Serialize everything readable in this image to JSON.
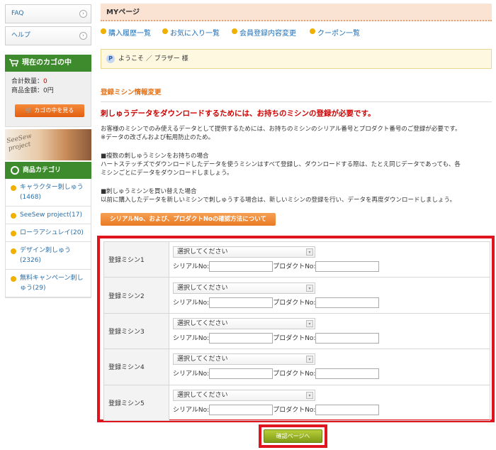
{
  "sidebar": {
    "links": [
      {
        "label": "FAQ"
      },
      {
        "label": "ヘルプ"
      }
    ],
    "cart": {
      "title": "現在のカゴの中",
      "total_qty_label": "合計数量：",
      "total_qty_value": "0",
      "total_price_label": "商品金額：",
      "total_price_value": "0円",
      "view_button": "カゴの中を見る"
    },
    "banner": {
      "logo_text": "SeeSew project"
    },
    "categories": {
      "title": "商品カテゴリ",
      "items": [
        {
          "label": "キャラクター刺しゅう(1468)"
        },
        {
          "label": "SeeSew project(17)"
        },
        {
          "label": "ローラアシュレイ(20)"
        },
        {
          "label": "デザイン刺しゅう(2326)"
        },
        {
          "label": "無料キャンペーン刺しゅう(29)"
        }
      ]
    }
  },
  "main": {
    "page_title": "MYページ",
    "tabs": [
      {
        "label": "購入履歴一覧"
      },
      {
        "label": "お気に入り一覧"
      },
      {
        "label": "会員登録内容変更"
      },
      {
        "label": "クーポン一覧"
      }
    ],
    "welcome": {
      "icon_letter": "P",
      "text": "ようこそ ／ ブラザー 様"
    },
    "section_title": "登録ミシン情報変更",
    "notice": "刺しゅうデータをダウンロードするためには、お持ちのミシンの登録が必要です。",
    "paragraphs": [
      "お客様のミシンでのみ使えるデータとして提供するためには、お持ちのミシンのシリアル番号とプロダクト番号のご登録が必要です。",
      "※データの改ざんおよび転用防止のため。",
      "■複数の刺しゅうミシンをお持ちの場合",
      "ハートステッチズでダウンロードしたデータを使うミシンはすべて登録し、ダウンロードする際は、たとえ同じデータであっても、各",
      "ミシンごとにデータをダウンロードしましょう。",
      "■刺しゅうミシンを買い替えた場合",
      "以前に購入したデータを新しいミシンで刺しゅうする場合は、新しいミシンの登録を行い、データを再度ダウンロードしましょう。"
    ],
    "help_button": "シリアルNo、および、プロダクトNoの確認方法について",
    "machines": [
      {
        "label": "登録ミシン1",
        "select": "選択してください",
        "serial_label": "シリアルNo:",
        "serial_value": "",
        "product_label": "プロダクトNo:",
        "product_value": ""
      },
      {
        "label": "登録ミシン2",
        "select": "選択してください",
        "serial_label": "シリアルNo:",
        "serial_value": "",
        "product_label": "プロダクトNo:",
        "product_value": ""
      },
      {
        "label": "登録ミシン3",
        "select": "選択してください",
        "serial_label": "シリアルNo:",
        "serial_value": "",
        "product_label": "プロダクトNo:",
        "product_value": ""
      },
      {
        "label": "登録ミシン4",
        "select": "選択してください",
        "serial_label": "シリアルNo:",
        "serial_value": "",
        "product_label": "プロダクトNo:",
        "product_value": ""
      },
      {
        "label": "登録ミシン5",
        "select": "選択してください",
        "serial_label": "シリアルNo:",
        "serial_value": "",
        "product_label": "プロダクトNo:",
        "product_value": ""
      }
    ],
    "confirm_button": "確認ページへ"
  },
  "colors": {
    "accent_green": "#3d8b2d",
    "highlight_red": "#e0141e",
    "link_blue": "#1e6fb7",
    "orange": "#e3731a"
  }
}
